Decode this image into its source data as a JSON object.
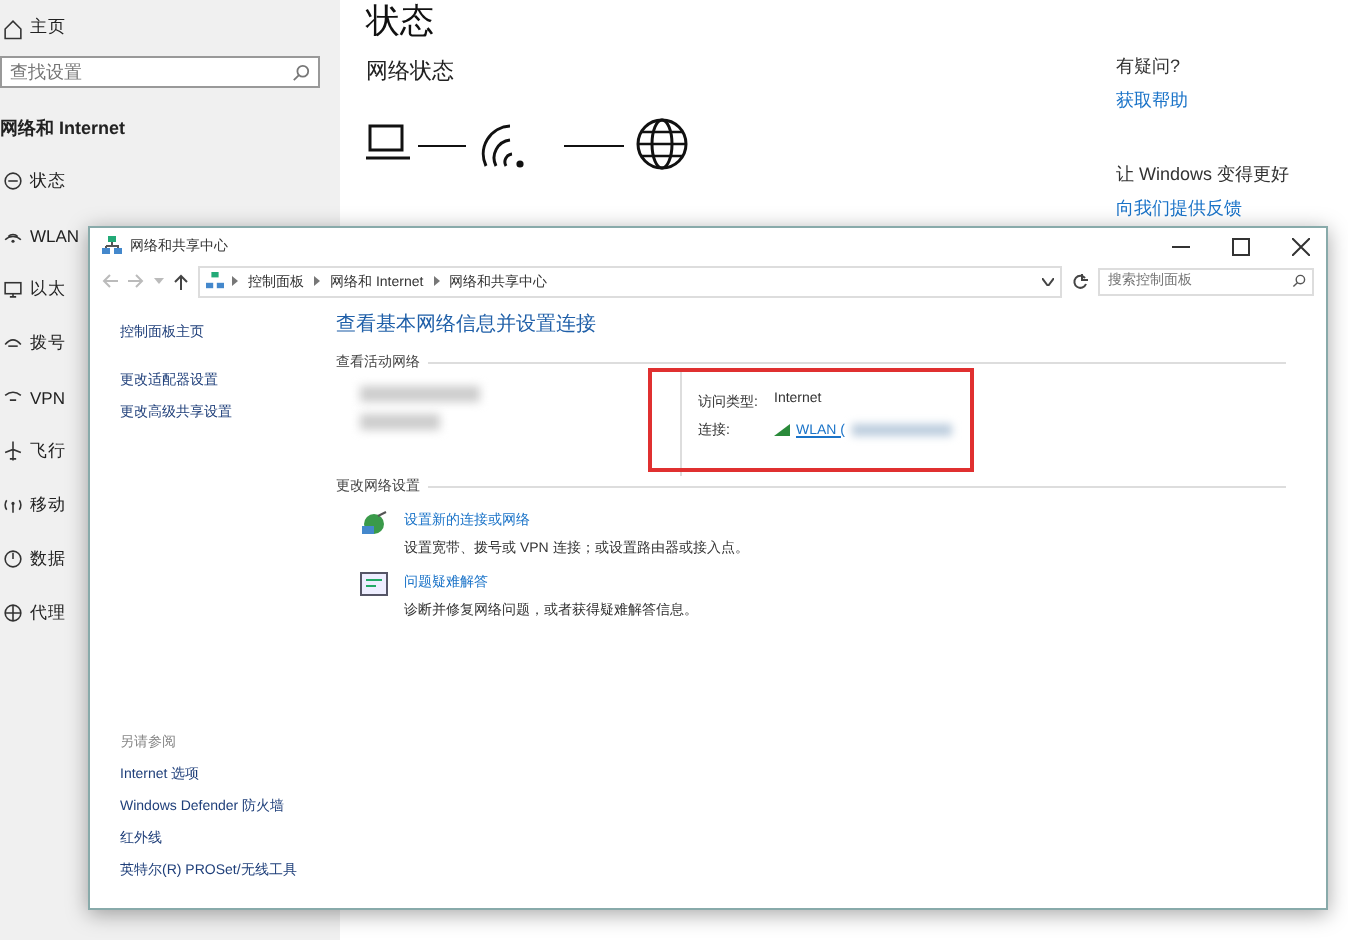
{
  "settings": {
    "home": "主页",
    "search": {
      "placeholder": "查找设置"
    },
    "section": "网络和 Internet",
    "nav": [
      {
        "label": "状态"
      },
      {
        "label": "WLAN"
      },
      {
        "label": "以太"
      },
      {
        "label": "拨号"
      },
      {
        "label": "VPN"
      },
      {
        "label": "飞行"
      },
      {
        "label": "移动"
      },
      {
        "label": "数据"
      },
      {
        "label": "代理"
      }
    ],
    "title": "状态",
    "subtitle": "网络状态",
    "side": [
      {
        "kind": "heading",
        "text": "有疑问?"
      },
      {
        "kind": "link",
        "text": "获取帮助"
      },
      {
        "kind": "heading",
        "text": "让 Windows 变得更好"
      },
      {
        "kind": "link",
        "text": "向我们提供反馈"
      }
    ]
  },
  "window": {
    "title": "网络和共享中心",
    "breadcrumb": [
      "控制面板",
      "网络和 Internet",
      "网络和共享中心"
    ],
    "search": {
      "placeholder": "搜索控制面板"
    },
    "left_links": [
      {
        "text": "控制面板主页"
      },
      {
        "text": "更改适配器设置"
      },
      {
        "text": "更改高级共享设置"
      }
    ],
    "see_also": {
      "heading": "另请参阅",
      "links": [
        "Internet 选项",
        "Windows Defender 防火墙",
        "红外线",
        "英特尔(R) PROSet/无线工具"
      ]
    },
    "heading": "查看基本网络信息并设置连接",
    "active_section": "查看活动网络",
    "access_label": "访问类型:",
    "access_value": "Internet",
    "connection_label": "连接:",
    "connection_link": "WLAN (",
    "change_section": "更改网络设置",
    "tasks": [
      {
        "link": "设置新的连接或网络",
        "description": "设置宽带、拨号或 VPN 连接；或设置路由器或接入点。"
      },
      {
        "link": "问题疑难解答",
        "description": "诊断并修复网络问题，或者获得疑难解答信息。"
      }
    ]
  }
}
